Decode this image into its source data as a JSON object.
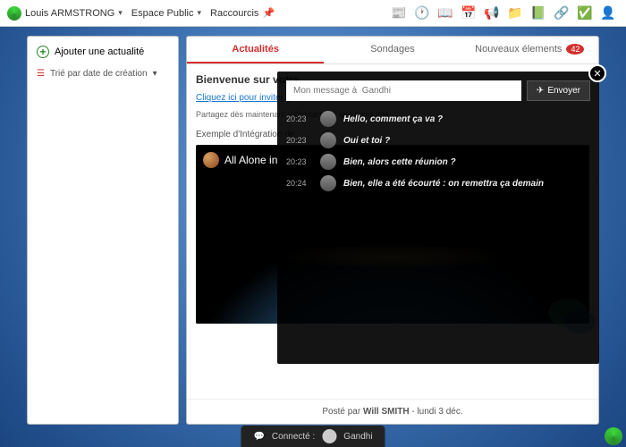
{
  "topbar": {
    "user": "Louis ARMSTRONG",
    "space": "Espace Public",
    "shortcuts": "Raccourcis"
  },
  "sidebar": {
    "add": "Ajouter une actualité",
    "sort": "Trié par date de création"
  },
  "tabs": {
    "news": "Actualités",
    "polls": "Sondages",
    "new_items": "Nouveaux élements",
    "badge": "42"
  },
  "content": {
    "welcome": "Bienvenue sur votre",
    "invite": "Cliquez ici pour inviter d",
    "desc": "Partagez dès maintenant v\nContacts ou des Liens Inte",
    "example": "Exemple d'Intégration de",
    "video_title": "All Alone in",
    "posted_prefix": "Posté par ",
    "posted_author": "Will SMITH",
    "posted_date": " - lundi 3 déc."
  },
  "chat": {
    "placeholder": "Mon message à  Gandhi",
    "send": "Envoyer",
    "messages": [
      {
        "time": "20:23",
        "text": "Hello, comment ça va ?"
      },
      {
        "time": "20:23",
        "text": "Oui et toi ?"
      },
      {
        "time": "20:23",
        "text": "Bien, alors cette réunion ?"
      },
      {
        "time": "20:24",
        "text": "Bien, elle a été écourté : on remettra ça demain"
      }
    ]
  },
  "status": {
    "label": "Connecté :",
    "name": "Gandhi"
  }
}
